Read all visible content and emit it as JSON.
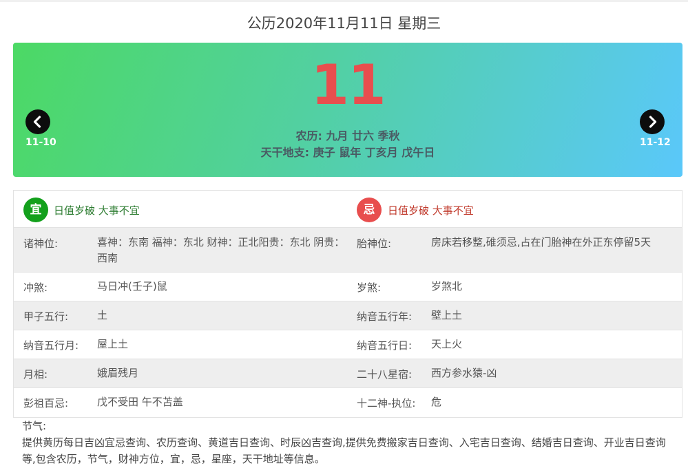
{
  "page": {
    "title": "公历2020年11月11日 星期三"
  },
  "banner": {
    "day": "11",
    "lunar": "农历: 九月 廿六  季秋",
    "ganzhi": "天干地支: 庚子 鼠年   丁亥月   戊午日",
    "prev_label": "11-10",
    "next_label": "11-12",
    "gradient_start": "#4cd964",
    "gradient_end": "#5ac8fa",
    "day_color": "#e84e4e"
  },
  "yiji": {
    "yi_badge": "宜",
    "yi_text": "日值岁破 大事不宜",
    "yi_color": "#13a01c",
    "ji_badge": "忌",
    "ji_text": "日值岁破 大事不宜",
    "ji_color": "#e84e4e"
  },
  "rows": [
    {
      "label1": "诸神位:",
      "value1": "喜神：东南 福神：东北 财神：正北阳贵：东北 阴贵：西南",
      "label2": "胎神位:",
      "value2": "房床若移整,碓须忌,占在门胎神在外正东停留5天"
    },
    {
      "label1": "冲煞:",
      "value1": "马日冲(壬子)鼠",
      "label2": "岁煞:",
      "value2": "岁煞北"
    },
    {
      "label1": "甲子五行:",
      "value1": "土",
      "label2": "纳音五行年:",
      "value2": "壁上土"
    },
    {
      "label1": "纳音五行月:",
      "value1": "屋上土",
      "label2": "纳音五行日:",
      "value2": "天上火"
    },
    {
      "label1": "月相:",
      "value1": "娥眉残月",
      "label2": "二十八星宿:",
      "value2": "西方参水猿-凶"
    },
    {
      "label1": "彭祖百忌:",
      "value1": "戊不受田 午不苫盖",
      "label2": "十二神-执位:",
      "value2": "危"
    }
  ],
  "footer": {
    "jieqi_label": "节气:",
    "description": "提供黄历每日吉凶宜忌查询、农历查询、黄道吉日查询、时辰凶吉查询,提供免费搬家吉日查询、入宅吉日查询、结婚吉日查询、开业吉日查询等,包含农历，节气，财神方位，宜，忌，星座，天干地址等信息。"
  },
  "icons": {
    "prev": "chevron-left-icon",
    "next": "chevron-right-icon"
  }
}
